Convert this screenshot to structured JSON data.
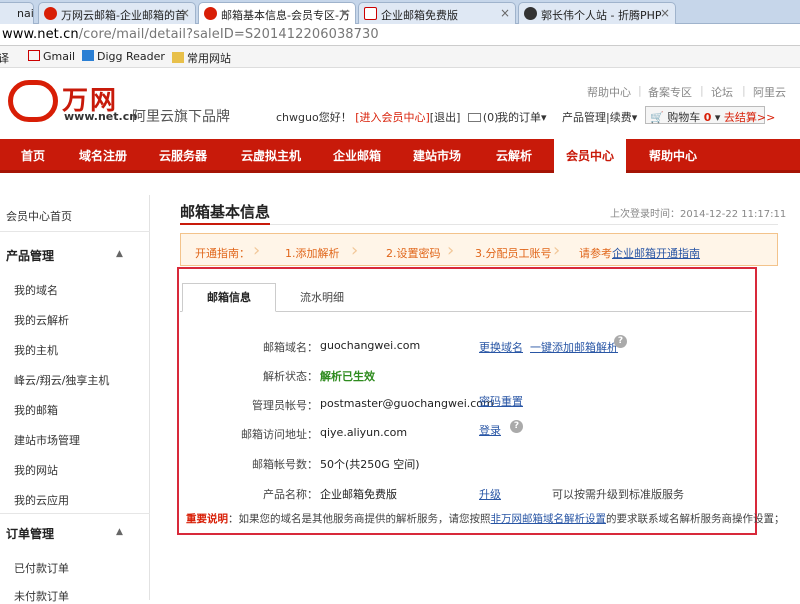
{
  "browser": {
    "tabs": [
      {
        "title": "nai"
      },
      {
        "title": "万网云邮箱-企业邮箱的首"
      },
      {
        "title": "邮箱基本信息-会员专区-万"
      },
      {
        "title": "企业邮箱免费版"
      },
      {
        "title": "郭长伟个人站 - 折腾PHP"
      }
    ],
    "url_host": "www.net.cn",
    "url_path": "/core/mail/detail?saleID=S201412206038730",
    "bookmarks": [
      "译",
      "Gmail",
      "Digg Reader",
      "常用网站"
    ]
  },
  "header": {
    "logo_text": "万网",
    "logo_url": "www.net.cn",
    "slogan": "阿里云旗下品牌",
    "top_links": [
      "帮助中心",
      "备案专区",
      "论坛",
      "阿里云"
    ],
    "greeting": "chwguo您好！",
    "member_link": "[进入会员中心]",
    "logout": "[退出]",
    "mail_count": "(0)",
    "my_orders": "我的订单",
    "product_mgmt": "产品管理|续费",
    "cart_label": "购物车",
    "cart_count": "0",
    "checkout": "去结算>>"
  },
  "nav": [
    "首页",
    "域名注册",
    "云服务器",
    "云虚拟主机",
    "企业邮箱",
    "建站市场",
    "云解析",
    "会员中心",
    "帮助中心"
  ],
  "sidebar": {
    "home": "会员中心首页",
    "product_heading": "产品管理",
    "product_items": [
      "我的域名",
      "我的云解析",
      "我的主机",
      "峰云/翔云/独享主机",
      "我的邮箱",
      "建站市场管理",
      "我的网站",
      "我的云应用"
    ],
    "order_heading": "订单管理",
    "order_items": [
      "已付款订单",
      "未付款订单"
    ]
  },
  "main": {
    "title": "邮箱基本信息",
    "last_login": "上次登录时间：2014-12-22 11:17:11",
    "guide": {
      "label": "开通指南：",
      "steps": [
        "1.添加解析",
        "2.设置密码",
        "3.分配员工账号"
      ],
      "ref_prefix": "请参考",
      "ref_link": "企业邮箱开通指南"
    },
    "tabs": [
      "邮箱信息",
      "流水明细"
    ],
    "rows": [
      {
        "label": "邮箱域名：",
        "value": "guochangwei.com"
      },
      {
        "label": "解析状态：",
        "value": "解析已生效"
      },
      {
        "label": "管理员帐号：",
        "value": "postmaster@guochangwei.com"
      },
      {
        "label": "邮箱访问地址：",
        "value": "qiye.aliyun.com"
      },
      {
        "label": "邮箱帐号数：",
        "value": "50个(共250G 空间)"
      },
      {
        "label": "产品名称：",
        "value": "企业邮箱免费版"
      }
    ],
    "actions": {
      "change_domain": "更换域名",
      "add_dns": "一键添加邮箱解析",
      "reset_pwd": "密码重置",
      "login": "登录",
      "upgrade": "升级",
      "upgrade_note": "可以按需升级到标准版服务"
    },
    "notice": {
      "label": "重要说明",
      "text1": "：如果您的域名是其他服务商提供的解析服务，请您按照",
      "link": "非万网邮箱域名解析设置",
      "text2": "的要求联系域名解析服务商操作设置；"
    }
  },
  "colors": {
    "brand_red": "#c81a0a",
    "link_blue": "#2956a5",
    "success_green": "#2e8b1e"
  }
}
